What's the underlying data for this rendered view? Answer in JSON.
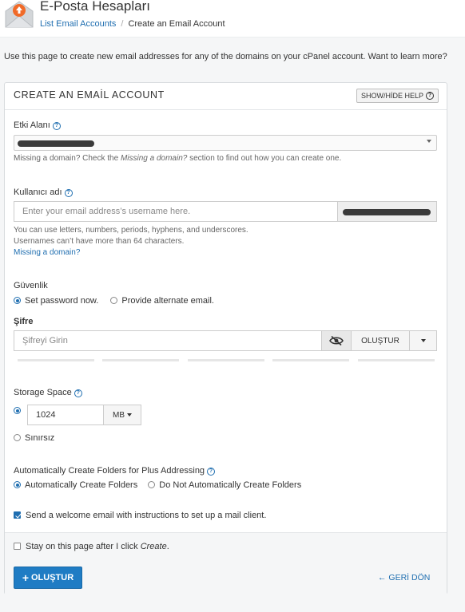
{
  "header": {
    "app_title": "E-Posta Hesapları",
    "breadcrumb_link": "List Email Accounts",
    "breadcrumb_separator": "/",
    "breadcrumb_current": "Create an Email Account",
    "icon": "envelope-upload-icon"
  },
  "intro_text": "Use this page to create new email addresses for any of the domains on your cPanel account. Want to learn more?",
  "panel": {
    "title": "CREATE AN EMAİL ACCOUNT",
    "help_button": "SHOW/HİDE HELP"
  },
  "domain": {
    "label": "Etki Alanı",
    "note_prefix": "Missing a domain? Check the ",
    "note_italic": "Missing a domain?",
    "note_suffix": " section to find out how you can create one."
  },
  "username": {
    "label": "Kullanıcı adı",
    "placeholder": "Enter your email address’s username here.",
    "note_line1": "You can use letters, numbers, periods, hyphens, and underscores.",
    "note_line2": "Usernames can’t have more than 64 characters.",
    "missing_link": "Missing a domain?"
  },
  "security": {
    "label": "Güvenlik",
    "option_set": "Set password now.",
    "option_alt": "Provide alternate email.",
    "selected": "Set password now."
  },
  "password": {
    "label": "Şifre",
    "placeholder": "Şifreyi Girin",
    "generate_label": "OLUŞTUR",
    "toggle_icon": "eye-slash-icon"
  },
  "storage": {
    "label": "Storage Space",
    "value": "1024",
    "unit": "MB",
    "unlimited_label": "Sınırsız",
    "selected": "custom"
  },
  "plus_addressing": {
    "label": "Automatically Create Folders for Plus Addressing",
    "option_auto": "Automatically Create Folders",
    "option_no": "Do Not Automatically Create Folders",
    "selected": "Automatically Create Folders"
  },
  "welcome_email": {
    "label": "Send a welcome email with instructions to set up a mail client.",
    "checked": true
  },
  "footer": {
    "stay_prefix": "Stay on this page after I click ",
    "stay_italic": "Create",
    "stay_suffix": ".",
    "stay_checked": false,
    "create_label": "OLUŞTUR",
    "back_label": "GERİ DÖN"
  },
  "colors": {
    "accent": "#1f7cc4",
    "link": "#1f6eb0"
  }
}
